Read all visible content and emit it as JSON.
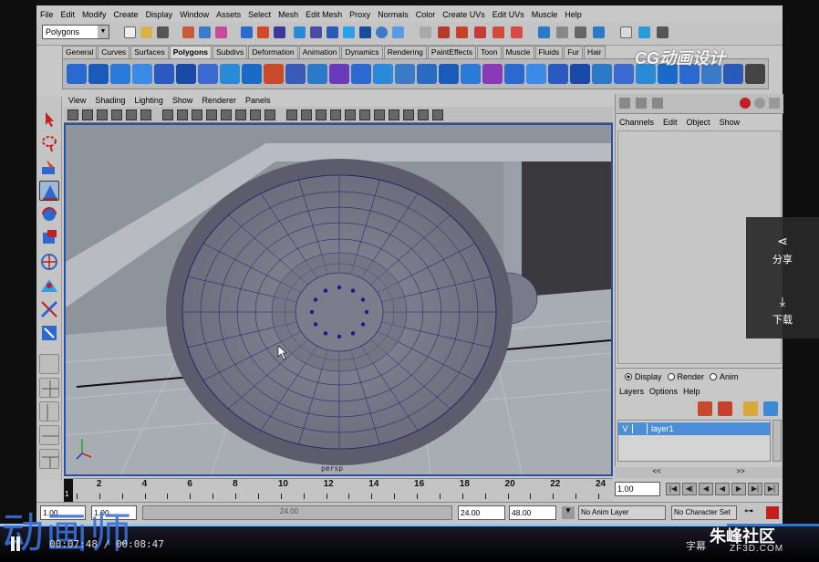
{
  "menubar": [
    "File",
    "Edit",
    "Modify",
    "Create",
    "Display",
    "Window",
    "Assets",
    "Select",
    "Mesh",
    "Edit Mesh",
    "Proxy",
    "Normals",
    "Color",
    "Create UVs",
    "Edit UVs",
    "Muscle",
    "Help"
  ],
  "statusline": {
    "mode": "Polygons"
  },
  "shelf_tabs": [
    "General",
    "Curves",
    "Surfaces",
    "Polygons",
    "Subdivs",
    "Deformation",
    "Animation",
    "Dynamics",
    "Rendering",
    "PaintEffects",
    "Toon",
    "Muscle",
    "Fluids",
    "Fur",
    "Hair"
  ],
  "active_shelf_tab": "Polygons",
  "panel_menu": [
    "View",
    "Shading",
    "Lighting",
    "Show",
    "Renderer",
    "Panels"
  ],
  "viewport": {
    "camera_label": "persp"
  },
  "channel_box": {
    "menu": [
      "Channels",
      "Edit",
      "Object",
      "Show"
    ]
  },
  "layer_editor": {
    "radios": [
      {
        "label": "Display",
        "on": true
      },
      {
        "label": "Render",
        "on": false
      },
      {
        "label": "Anim",
        "on": false
      }
    ],
    "menu": [
      "Layers",
      "Options",
      "Help"
    ],
    "layer": {
      "v": "V",
      "name": "layer1"
    }
  },
  "time_slider": {
    "ticks": [
      "2",
      "4",
      "6",
      "8",
      "10",
      "12",
      "14",
      "16",
      "18",
      "20",
      "22",
      "24"
    ],
    "current_frame": "1"
  },
  "playback": {
    "current_time": "1.00",
    "prev_key": "<<",
    "next_key": ">>"
  },
  "range_slider": {
    "start": "1.00",
    "inner_start": "1.00",
    "range_label": "24.00",
    "end": "24.00",
    "outer_end": "48.00",
    "anim_layer": "No Anim Layer",
    "character_set": "No Character Set"
  },
  "player": {
    "watermark": "动画师",
    "time": "00:07:48 / 00:08:47",
    "subtitle_btn": "字幕",
    "site_logo": "朱峰社区",
    "site_url": "ZF3D.COM",
    "share": "分享",
    "download": "下载",
    "overlay_logo": "CG动画设计",
    "progress": 0.888
  },
  "colors": {
    "viewport_border": "#2a4fa0",
    "layer_highlight": "#4c8fd8",
    "accent": "#2a7bd8"
  }
}
